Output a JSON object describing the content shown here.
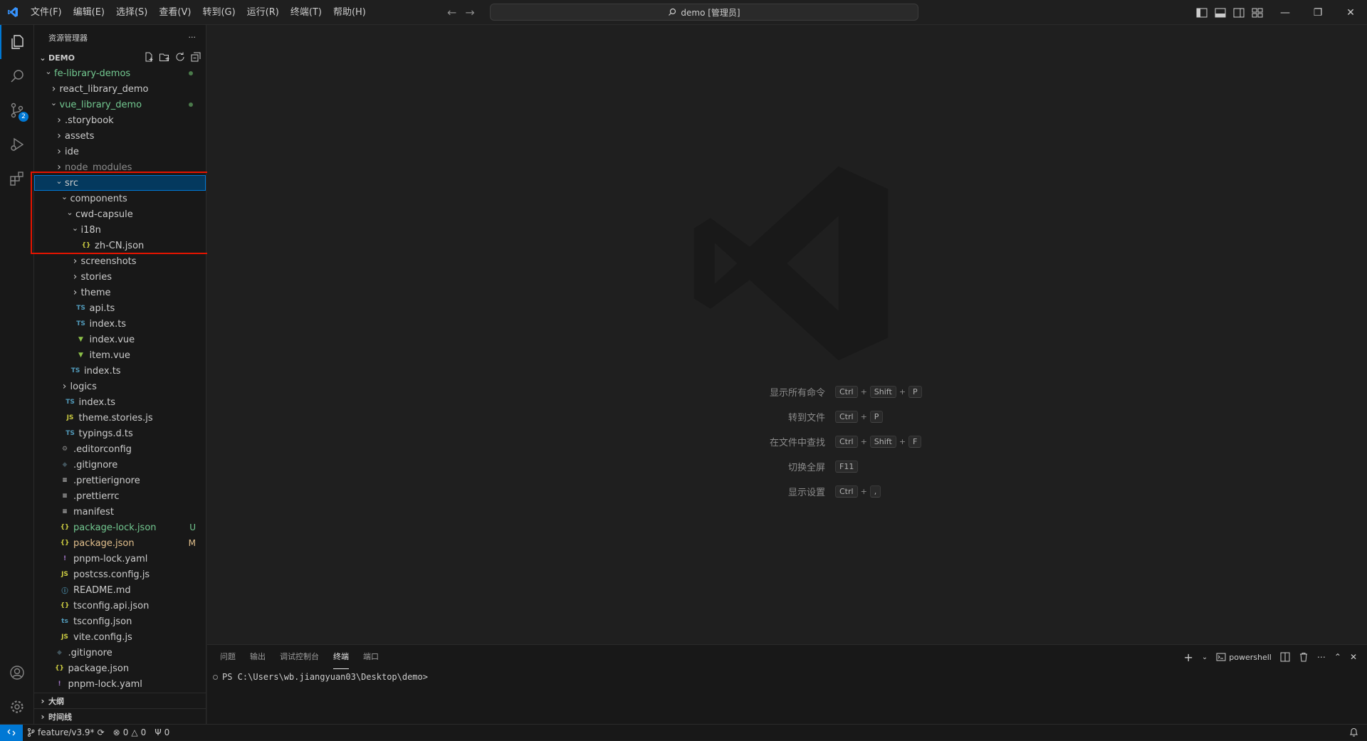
{
  "titlebar": {
    "menu": [
      "文件(F)",
      "编辑(E)",
      "选择(S)",
      "查看(V)",
      "转到(G)",
      "运行(R)",
      "终端(T)",
      "帮助(H)"
    ],
    "search_text": "demo [管理员]"
  },
  "activity": {
    "scm_badge": "2"
  },
  "sidebar": {
    "title": "资源管理器",
    "more": "···",
    "root": "DEMO",
    "outline": "大纲",
    "timeline": "时间线"
  },
  "tree": [
    {
      "label": "fe-library-demos",
      "depth": 0,
      "type": "folder",
      "open": true,
      "color": "#73c991",
      "dot": true
    },
    {
      "label": "react_library_demo",
      "depth": 1,
      "type": "folder",
      "open": false
    },
    {
      "label": "vue_library_demo",
      "depth": 1,
      "type": "folder",
      "open": true,
      "color": "#73c991",
      "dot": true
    },
    {
      "label": ".storybook",
      "depth": 2,
      "type": "folder",
      "open": false
    },
    {
      "label": "assets",
      "depth": 2,
      "type": "folder",
      "open": false
    },
    {
      "label": "ide",
      "depth": 2,
      "type": "folder",
      "open": false
    },
    {
      "label": "node_modules",
      "depth": 2,
      "type": "folder",
      "open": false,
      "color": "#8c8c8c"
    },
    {
      "label": "src",
      "depth": 2,
      "type": "folder",
      "open": true,
      "selected": true
    },
    {
      "label": "components",
      "depth": 3,
      "type": "folder",
      "open": true
    },
    {
      "label": "cwd-capsule",
      "depth": 4,
      "type": "folder",
      "open": true
    },
    {
      "label": "i18n",
      "depth": 5,
      "type": "folder",
      "open": true
    },
    {
      "label": "zh-CN.json",
      "depth": 6,
      "type": "json"
    },
    {
      "label": "screenshots",
      "depth": 5,
      "type": "folder",
      "open": false
    },
    {
      "label": "stories",
      "depth": 5,
      "type": "folder",
      "open": false
    },
    {
      "label": "theme",
      "depth": 5,
      "type": "folder",
      "open": false
    },
    {
      "label": "api.ts",
      "depth": 5,
      "type": "ts"
    },
    {
      "label": "index.ts",
      "depth": 5,
      "type": "ts"
    },
    {
      "label": "index.vue",
      "depth": 5,
      "type": "vue"
    },
    {
      "label": "item.vue",
      "depth": 5,
      "type": "vue"
    },
    {
      "label": "index.ts",
      "depth": 4,
      "type": "ts"
    },
    {
      "label": "logics",
      "depth": 3,
      "type": "folder",
      "open": false
    },
    {
      "label": "index.ts",
      "depth": 3,
      "type": "ts"
    },
    {
      "label": "theme.stories.js",
      "depth": 3,
      "type": "js"
    },
    {
      "label": "typings.d.ts",
      "depth": 3,
      "type": "ts"
    },
    {
      "label": ".editorconfig",
      "depth": 2,
      "type": "gear"
    },
    {
      "label": ".gitignore",
      "depth": 2,
      "type": "git"
    },
    {
      "label": ".prettierignore",
      "depth": 2,
      "type": "lines"
    },
    {
      "label": ".prettierrc",
      "depth": 2,
      "type": "lines"
    },
    {
      "label": "manifest",
      "depth": 2,
      "type": "lines"
    },
    {
      "label": "package-lock.json",
      "depth": 2,
      "type": "json",
      "color": "#73c991",
      "deco": "U",
      "deco_color": "#73c991"
    },
    {
      "label": "package.json",
      "depth": 2,
      "type": "json",
      "color": "#e2c08d",
      "deco": "M",
      "deco_color": "#e2c08d"
    },
    {
      "label": "pnpm-lock.yaml",
      "depth": 2,
      "type": "yaml"
    },
    {
      "label": "postcss.config.js",
      "depth": 2,
      "type": "js"
    },
    {
      "label": "README.md",
      "depth": 2,
      "type": "info"
    },
    {
      "label": "tsconfig.api.json",
      "depth": 2,
      "type": "json"
    },
    {
      "label": "tsconfig.json",
      "depth": 2,
      "type": "tsconfig"
    },
    {
      "label": "vite.config.js",
      "depth": 2,
      "type": "js"
    },
    {
      "label": ".gitignore",
      "depth": 1,
      "type": "git"
    },
    {
      "label": "package.json",
      "depth": 1,
      "type": "json"
    },
    {
      "label": "pnpm-lock.yaml",
      "depth": 1,
      "type": "yaml"
    }
  ],
  "shortcuts": [
    {
      "label": "显示所有命令",
      "keys": [
        "Ctrl",
        "Shift",
        "P"
      ]
    },
    {
      "label": "转到文件",
      "keys": [
        "Ctrl",
        "P"
      ]
    },
    {
      "label": "在文件中查找",
      "keys": [
        "Ctrl",
        "Shift",
        "F"
      ]
    },
    {
      "label": "切换全屏",
      "keys": [
        "F11"
      ]
    },
    {
      "label": "显示设置",
      "keys": [
        "Ctrl",
        ","
      ]
    }
  ],
  "panel": {
    "tabs": [
      "问题",
      "输出",
      "调试控制台",
      "终端",
      "端口"
    ],
    "active_tab": 3,
    "shell": "powershell",
    "prompt": "PS C:\\Users\\wb.jiangyuan03\\Desktop\\demo>"
  },
  "status": {
    "branch": "feature/v3.9*",
    "errors": "0",
    "warnings": "0",
    "ports": "0"
  },
  "colors": {
    "accent": "#0078d4",
    "highlight": "#e51400",
    "untracked": "#73c991",
    "modified": "#e2c08d"
  }
}
